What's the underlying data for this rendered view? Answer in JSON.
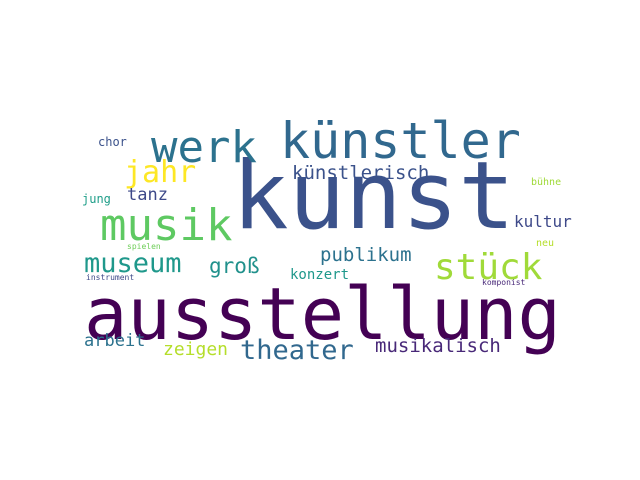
{
  "words": [
    {
      "text": "kunst",
      "color": "#3b528b"
    },
    {
      "text": "ausstellung",
      "color": "#440154"
    },
    {
      "text": "künstler",
      "color": "#31688e"
    },
    {
      "text": "werk",
      "color": "#2c728e"
    },
    {
      "text": "musik",
      "color": "#5ec962"
    },
    {
      "text": "stück",
      "color": "#a0da39"
    },
    {
      "text": "museum",
      "color": "#1f988b"
    },
    {
      "text": "theater",
      "color": "#31688e"
    },
    {
      "text": "jahr",
      "color": "#fde725"
    },
    {
      "text": "künstlerisch",
      "color": "#3b528b"
    },
    {
      "text": "groß",
      "color": "#21918c"
    },
    {
      "text": "publikum",
      "color": "#2c728e"
    },
    {
      "text": "musikalisch",
      "color": "#482878"
    },
    {
      "text": "zeigen",
      "color": "#b5de2b"
    },
    {
      "text": "arbeit",
      "color": "#2c728e"
    },
    {
      "text": "tanz",
      "color": "#3e4989"
    },
    {
      "text": "kultur",
      "color": "#3e4989"
    },
    {
      "text": "konzert",
      "color": "#1f988b"
    },
    {
      "text": "chor",
      "color": "#3b528b"
    },
    {
      "text": "jung",
      "color": "#1f9e89"
    },
    {
      "text": "bühne",
      "color": "#a0da39"
    },
    {
      "text": "neu",
      "color": "#b5de2b"
    },
    {
      "text": "spielen",
      "color": "#6ece58"
    },
    {
      "text": "instrument",
      "color": "#3e4989"
    },
    {
      "text": "komponist",
      "color": "#482878"
    }
  ]
}
